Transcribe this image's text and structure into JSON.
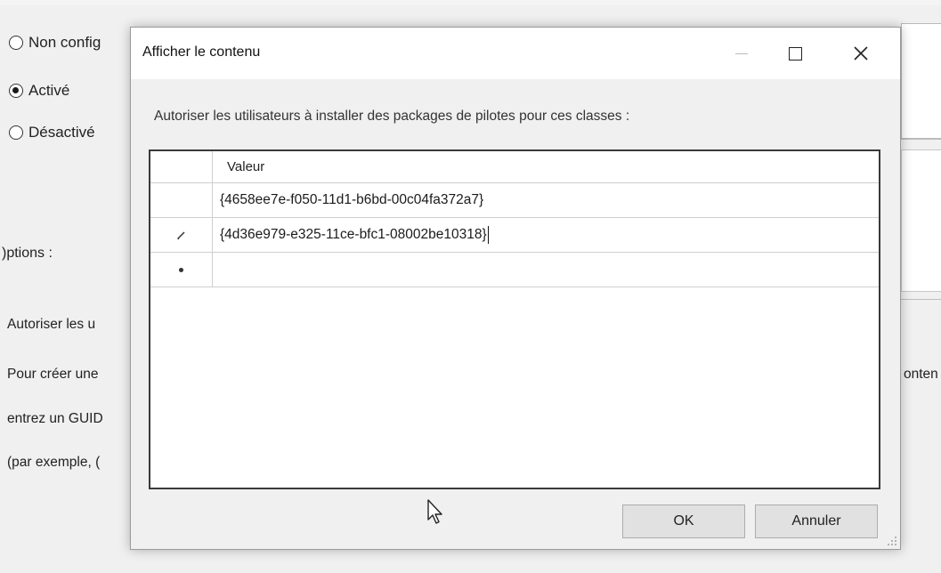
{
  "background": {
    "radios": [
      {
        "label": "Non config",
        "checked": false
      },
      {
        "label": "Activé",
        "checked": true
      },
      {
        "label": "Désactivé",
        "checked": false
      }
    ],
    "options_label": ")ptions :",
    "help_lines": [
      "Autoriser les u",
      "Pour créer une",
      "entrez un GUID",
      "(par exemple, ("
    ],
    "right_fragment": "onten"
  },
  "dialog": {
    "title": "Afficher le contenu",
    "prompt": "Autoriser les utilisateurs à installer des packages de pilotes pour ces classes :",
    "column_header": "Valeur",
    "rows": [
      {
        "marker": "",
        "value": "{4658ee7e-f050-11d1-b6bd-00c04fa372a7}"
      },
      {
        "marker": "✎",
        "value": "{4d36e979-e325-11ce-bfc1-08002be10318}"
      },
      {
        "marker": "*",
        "value": ""
      }
    ],
    "ok_label": "OK",
    "cancel_label": "Annuler"
  },
  "icons": {
    "minimize": "minimize-icon",
    "maximize": "maximize-icon",
    "close": "close-icon",
    "edit_row": "pencil-icon",
    "new_row": "new-row-icon",
    "cursor": "mouse-pointer-icon"
  }
}
